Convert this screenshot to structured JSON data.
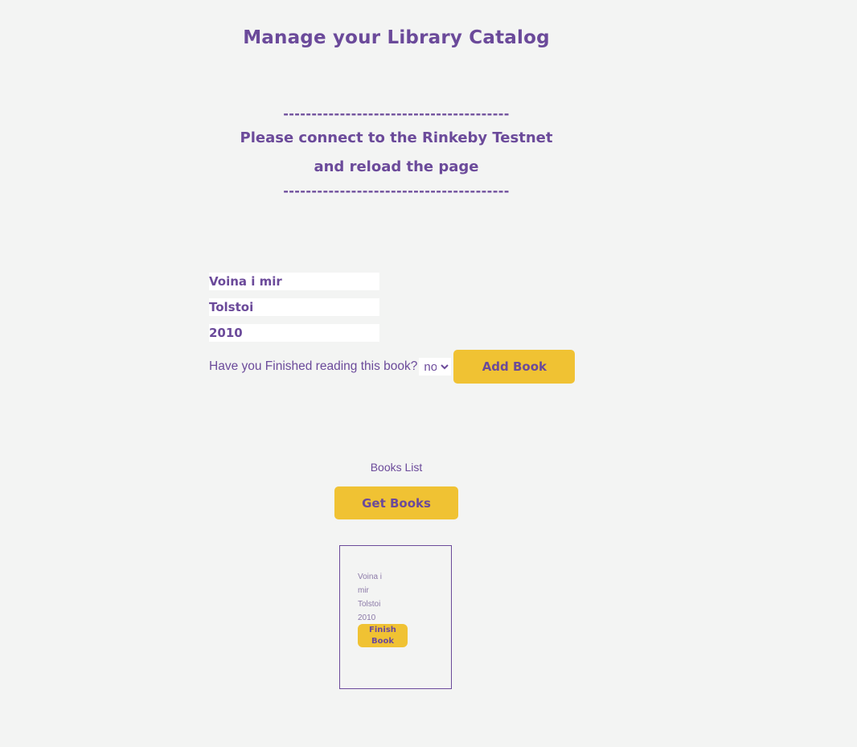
{
  "header": {
    "title": "Manage your Library Catalog"
  },
  "notice": {
    "divider": "----------------------------------------",
    "line1": "Please connect to the Rinkeby Testnet",
    "line2": "and reload the page"
  },
  "form": {
    "title_value": "Voina i mir",
    "author_value": "Tolstoi",
    "year_value": "2010",
    "finished_label": "Have you Finished reading this book?",
    "finished_selected": "no",
    "add_button_label": "Add Book"
  },
  "books_section": {
    "title": "Books List",
    "get_button_label": "Get Books",
    "books": [
      {
        "title": "Voina i mir",
        "author": "Tolstoi",
        "year": "2010",
        "finish_button_label": "Finish Book"
      }
    ]
  },
  "colors": {
    "background": "#f3f4f3",
    "primary_text": "#6b4a9a",
    "button_bg": "#f0c233"
  }
}
